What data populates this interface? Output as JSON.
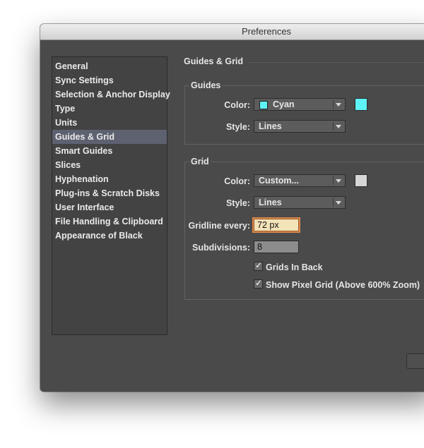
{
  "window": {
    "title": "Preferences"
  },
  "sidebar": {
    "items": [
      {
        "label": "General"
      },
      {
        "label": "Sync Settings"
      },
      {
        "label": "Selection & Anchor Display"
      },
      {
        "label": "Type"
      },
      {
        "label": "Units"
      },
      {
        "label": "Guides & Grid",
        "selected": true
      },
      {
        "label": "Smart Guides"
      },
      {
        "label": "Slices"
      },
      {
        "label": "Hyphenation"
      },
      {
        "label": "Plug-ins & Scratch Disks"
      },
      {
        "label": "User Interface"
      },
      {
        "label": "File Handling & Clipboard"
      },
      {
        "label": "Appearance of Black"
      }
    ]
  },
  "panel": {
    "title": "Guides & Grid"
  },
  "guides": {
    "legend": "Guides",
    "color_label": "Color:",
    "color_value": "Cyan",
    "color_hex": "#5ef4f6",
    "style_label": "Style:",
    "style_value": "Lines"
  },
  "grid": {
    "legend": "Grid",
    "color_label": "Color:",
    "color_value": "Custom...",
    "color_hex": "#d6d6d6",
    "style_label": "Style:",
    "style_value": "Lines",
    "gridline_label": "Gridline every:",
    "gridline_value": "72 px",
    "subdivisions_label": "Subdivisions:",
    "subdivisions_value": "8",
    "grids_in_back_label": "Grids In Back",
    "grids_in_back_checked": true,
    "pixel_grid_label": "Show Pixel Grid (Above 600% Zoom)",
    "pixel_grid_checked": true
  },
  "check_glyph": "✓"
}
